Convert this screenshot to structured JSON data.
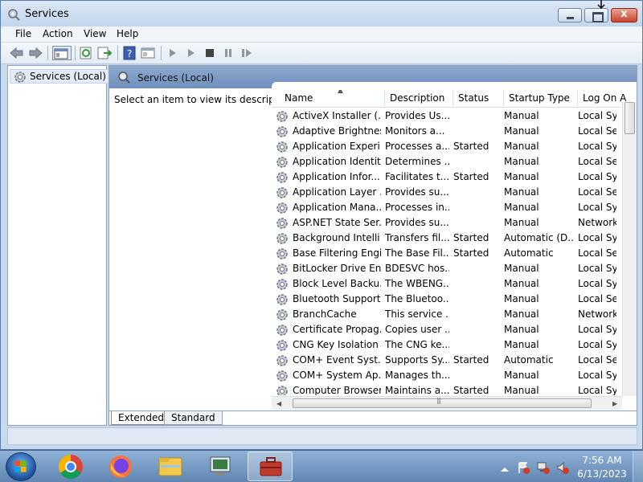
{
  "window": {
    "title": "Services",
    "close_glyph": "x"
  },
  "menu": [
    "File",
    "Action",
    "View",
    "Help"
  ],
  "tree": {
    "root": "Services (Local)"
  },
  "pane": {
    "title": "Services (Local)",
    "description_hint": "Select an item to view its description."
  },
  "columns": [
    "Name",
    "Description",
    "Status",
    "Startup Type",
    "Log On A"
  ],
  "services": [
    [
      "ActiveX Installer (...",
      "Provides Us...",
      "",
      "Manual",
      "Local Syst"
    ],
    [
      "Adaptive Brightness",
      "Monitors a...",
      "",
      "Manual",
      "Local Serv"
    ],
    [
      "Application Experi...",
      "Processes a...",
      "Started",
      "Manual",
      "Local Syst"
    ],
    [
      "Application Identity",
      "Determines ...",
      "",
      "Manual",
      "Local Serv"
    ],
    [
      "Application Infor...",
      "Facilitates t...",
      "Started",
      "Manual",
      "Local Syst"
    ],
    [
      "Application Layer ...",
      "Provides su...",
      "",
      "Manual",
      "Local Serv"
    ],
    [
      "Application Mana...",
      "Processes in...",
      "",
      "Manual",
      "Local Syst"
    ],
    [
      "ASP.NET State Ser...",
      "Provides su...",
      "",
      "Manual",
      "Network S"
    ],
    [
      "Background Intelli...",
      "Transfers fil...",
      "Started",
      "Automatic (D...",
      "Local Syst"
    ],
    [
      "Base Filtering Engi...",
      "The Base Fil...",
      "Started",
      "Automatic",
      "Local Serv"
    ],
    [
      "BitLocker Drive En...",
      "BDESVC hos...",
      "",
      "Manual",
      "Local Syst"
    ],
    [
      "Block Level Backu...",
      "The WBENG...",
      "",
      "Manual",
      "Local Syst"
    ],
    [
      "Bluetooth Support...",
      "The Bluetoo...",
      "",
      "Manual",
      "Local Serv"
    ],
    [
      "BranchCache",
      "This service ...",
      "",
      "Manual",
      "Network S"
    ],
    [
      "Certificate Propag...",
      "Copies user ...",
      "",
      "Manual",
      "Local Syst"
    ],
    [
      "CNG Key Isolation",
      "The CNG ke...",
      "",
      "Manual",
      "Local Syst"
    ],
    [
      "COM+ Event Syst...",
      "Supports Sy...",
      "Started",
      "Automatic",
      "Local Serv"
    ],
    [
      "COM+ System Ap...",
      "Manages th...",
      "",
      "Manual",
      "Local Syst"
    ],
    [
      "Computer Browser",
      "Maintains a...",
      "Started",
      "Manual",
      "Local Syst"
    ]
  ],
  "tabs": {
    "extended": "Extended",
    "standard": "Standard"
  },
  "clock": {
    "time": "7:56 AM",
    "date": "6/13/2023"
  },
  "taskbar_apps": [
    "chrome-icon",
    "firefox-icon",
    "file-explorer-icon",
    "computer-management-icon",
    "services-toolbox-icon"
  ],
  "colors": {
    "header_blue": "#6f8fbd",
    "taskbar": "#5f85b1",
    "close_red": "#c8432a"
  }
}
